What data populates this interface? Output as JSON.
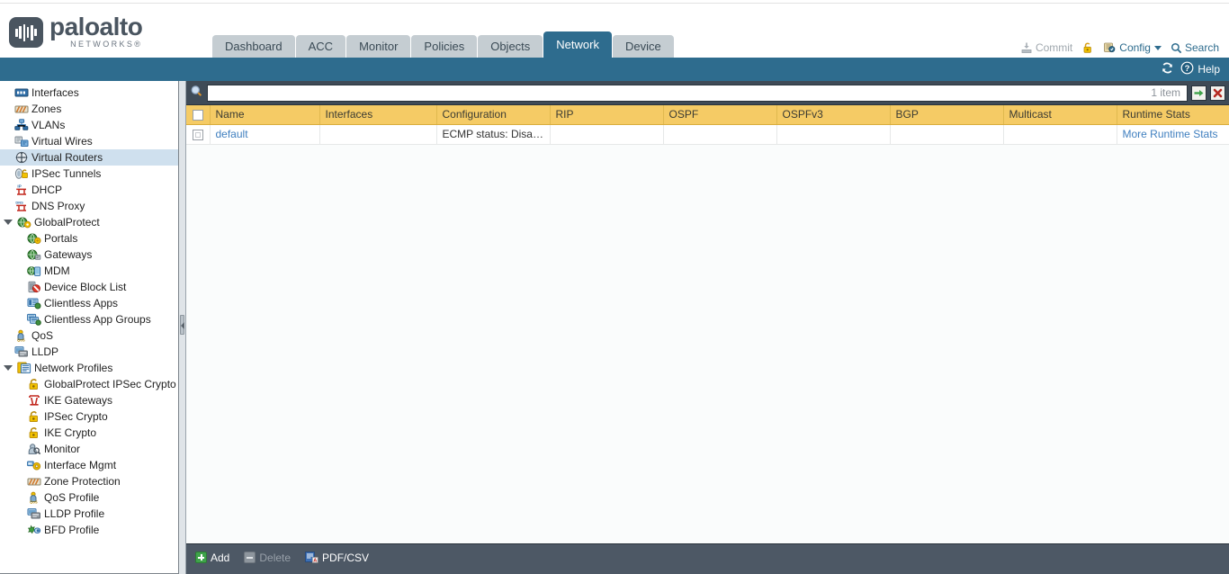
{
  "brand": {
    "name": "paloalto",
    "tagline": "NETWORKS",
    "registered": "®",
    "logo_icon": "paloalto-logo-icon"
  },
  "colors": {
    "header_blue": "#2e6c8e",
    "tab_inactive": "#c5cdd2",
    "table_header_yellow": "#f5cb65",
    "chrome_dark": "#3f4b57",
    "toolbar_dark": "#4d5865",
    "link_blue": "#3f7fbf",
    "selected_row": "#cfe0ee",
    "add_green": "#3fa34a"
  },
  "tabs": [
    {
      "label": "Dashboard",
      "active": false
    },
    {
      "label": "ACC",
      "active": false
    },
    {
      "label": "Monitor",
      "active": false
    },
    {
      "label": "Policies",
      "active": false
    },
    {
      "label": "Objects",
      "active": false
    },
    {
      "label": "Network",
      "active": true
    },
    {
      "label": "Device",
      "active": false
    }
  ],
  "header_actions": {
    "commit": {
      "label": "Commit",
      "icon": "commit-icon",
      "disabled": true
    },
    "lock": {
      "label": "",
      "icon": "padlock-icon"
    },
    "config": {
      "label": "Config",
      "icon": "config-icon",
      "caret": "chevron-down-icon"
    },
    "search": {
      "label": "Search",
      "icon": "search-icon"
    }
  },
  "bluebar": {
    "refresh": {
      "label": "",
      "icon": "refresh-icon"
    },
    "help": {
      "label": "Help",
      "icon": "help-circle-icon"
    }
  },
  "sidebar": {
    "items": [
      {
        "label": "Interfaces",
        "icon": "interfaces-icon",
        "level": 0,
        "selected": false,
        "expandable": false
      },
      {
        "label": "Zones",
        "icon": "zones-icon",
        "level": 0,
        "selected": false,
        "expandable": false
      },
      {
        "label": "VLANs",
        "icon": "vlans-icon",
        "level": 0,
        "selected": false,
        "expandable": false
      },
      {
        "label": "Virtual Wires",
        "icon": "virtual-wires-icon",
        "level": 0,
        "selected": false,
        "expandable": false
      },
      {
        "label": "Virtual Routers",
        "icon": "virtual-routers-icon",
        "level": 0,
        "selected": true,
        "expandable": false
      },
      {
        "label": "IPSec Tunnels",
        "icon": "ipsec-tunnels-icon",
        "level": 0,
        "selected": false,
        "expandable": false
      },
      {
        "label": "DHCP",
        "icon": "dhcp-icon",
        "level": 0,
        "selected": false,
        "expandable": false
      },
      {
        "label": "DNS Proxy",
        "icon": "dns-proxy-icon",
        "level": 0,
        "selected": false,
        "expandable": false
      },
      {
        "label": "GlobalProtect",
        "icon": "globalprotect-icon",
        "level": 0,
        "selected": false,
        "expandable": true,
        "expanded": true
      },
      {
        "label": "Portals",
        "icon": "portals-icon",
        "level": 1,
        "selected": false,
        "expandable": false
      },
      {
        "label": "Gateways",
        "icon": "gateways-icon",
        "level": 1,
        "selected": false,
        "expandable": false
      },
      {
        "label": "MDM",
        "icon": "mdm-icon",
        "level": 1,
        "selected": false,
        "expandable": false
      },
      {
        "label": "Device Block List",
        "icon": "device-block-list-icon",
        "level": 1,
        "selected": false,
        "expandable": false
      },
      {
        "label": "Clientless Apps",
        "icon": "clientless-apps-icon",
        "level": 1,
        "selected": false,
        "expandable": false
      },
      {
        "label": "Clientless App Groups",
        "icon": "clientless-app-groups-icon",
        "level": 1,
        "selected": false,
        "expandable": false
      },
      {
        "label": "QoS",
        "icon": "qos-icon",
        "level": 0,
        "selected": false,
        "expandable": false
      },
      {
        "label": "LLDP",
        "icon": "lldp-icon",
        "level": 0,
        "selected": false,
        "expandable": false
      },
      {
        "label": "Network Profiles",
        "icon": "network-profiles-icon",
        "level": 0,
        "selected": false,
        "expandable": true,
        "expanded": true
      },
      {
        "label": "GlobalProtect IPSec Crypto",
        "icon": "lock-icon",
        "level": 1,
        "selected": false,
        "expandable": false
      },
      {
        "label": "IKE Gateways",
        "icon": "ike-gateways-icon",
        "level": 1,
        "selected": false,
        "expandable": false
      },
      {
        "label": "IPSec Crypto",
        "icon": "lock-icon",
        "level": 1,
        "selected": false,
        "expandable": false
      },
      {
        "label": "IKE Crypto",
        "icon": "lock-icon",
        "level": 1,
        "selected": false,
        "expandable": false
      },
      {
        "label": "Monitor",
        "icon": "monitor-profile-icon",
        "level": 1,
        "selected": false,
        "expandable": false
      },
      {
        "label": "Interface Mgmt",
        "icon": "interface-mgmt-icon",
        "level": 1,
        "selected": false,
        "expandable": false
      },
      {
        "label": "Zone Protection",
        "icon": "zone-protection-icon",
        "level": 1,
        "selected": false,
        "expandable": false
      },
      {
        "label": "QoS Profile",
        "icon": "qos-profile-icon",
        "level": 1,
        "selected": false,
        "expandable": false
      },
      {
        "label": "LLDP Profile",
        "icon": "lldp-profile-icon",
        "level": 1,
        "selected": false,
        "expandable": false
      },
      {
        "label": "BFD Profile",
        "icon": "bfd-profile-icon",
        "level": 1,
        "selected": false,
        "expandable": false
      }
    ]
  },
  "search": {
    "value": "",
    "placeholder": "",
    "icon": "search-icon",
    "item_count": "1 item",
    "apply_icon": "green-arrow-icon",
    "clear_icon": "red-x-icon"
  },
  "table": {
    "columns": [
      "Name",
      "Interfaces",
      "Configuration",
      "RIP",
      "OSPF",
      "OSPFv3",
      "BGP",
      "Multicast",
      "Runtime Stats"
    ],
    "rows": [
      {
        "checked": false,
        "name": "default",
        "interfaces": "",
        "configuration": "ECMP status: Disabled",
        "rip": "",
        "ospf": "",
        "ospfv3": "",
        "bgp": "",
        "multicast": "",
        "runtime_stats": "More Runtime Stats"
      }
    ]
  },
  "bottom_toolbar": {
    "add": {
      "label": "Add",
      "icon": "plus-icon",
      "disabled": false
    },
    "delete": {
      "label": "Delete",
      "icon": "minus-icon",
      "disabled": true
    },
    "pdfcsv": {
      "label": "PDF/CSV",
      "icon": "pdf-csv-icon",
      "disabled": false
    }
  }
}
